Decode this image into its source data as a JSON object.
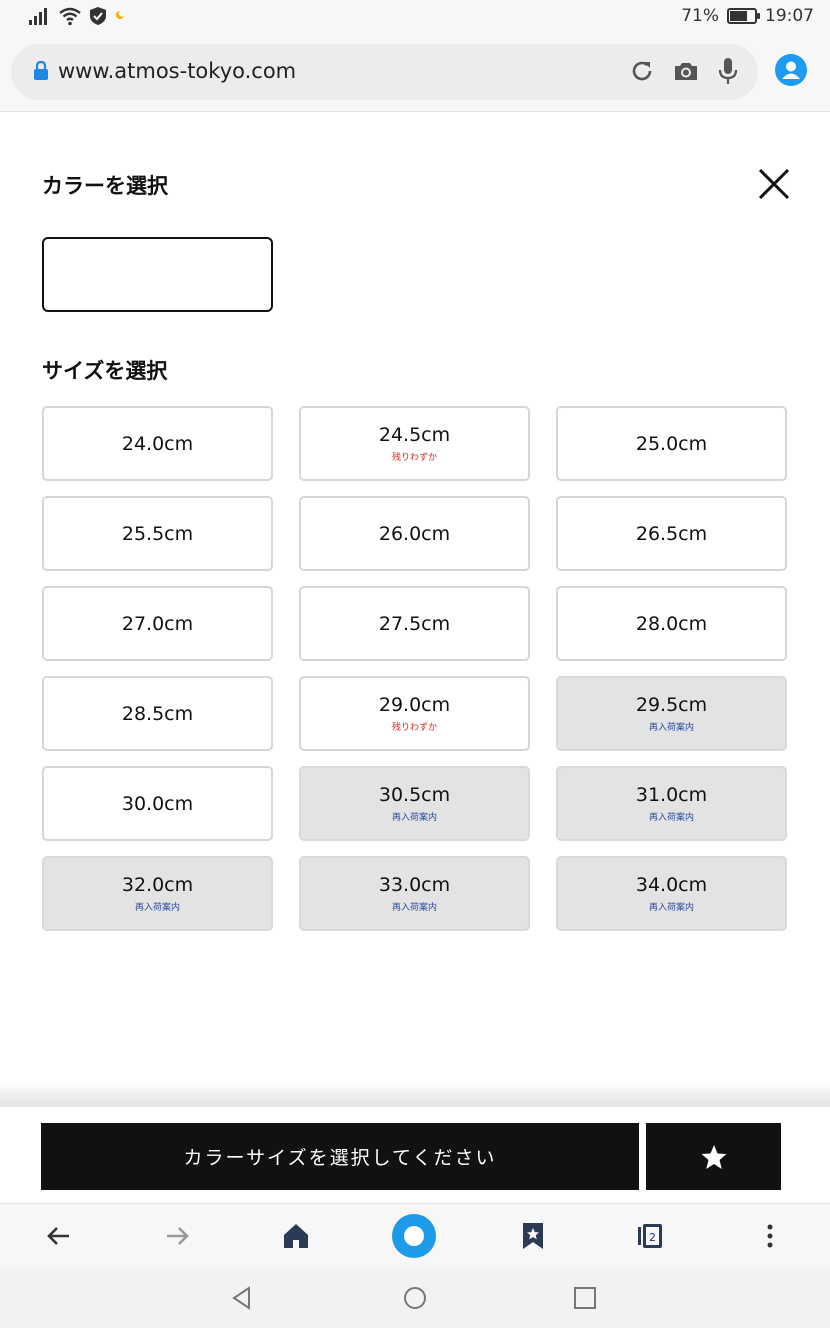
{
  "status_bar": {
    "battery": "71%",
    "time": "19:07",
    "battery_level": 0.71
  },
  "browser": {
    "url": "www.atmos-tokyo.com",
    "tab_count": "2"
  },
  "modal": {
    "color_heading": "カラーを選択",
    "size_heading": "サイズを選択",
    "color_value": "",
    "sizes": [
      {
        "label": "24.0cm",
        "note": "",
        "state": "available"
      },
      {
        "label": "24.5cm",
        "note": "残りわずか",
        "state": "low"
      },
      {
        "label": "25.0cm",
        "note": "",
        "state": "available"
      },
      {
        "label": "25.5cm",
        "note": "",
        "state": "available"
      },
      {
        "label": "26.0cm",
        "note": "",
        "state": "available"
      },
      {
        "label": "26.5cm",
        "note": "",
        "state": "available"
      },
      {
        "label": "27.0cm",
        "note": "",
        "state": "available"
      },
      {
        "label": "27.5cm",
        "note": "",
        "state": "available"
      },
      {
        "label": "28.0cm",
        "note": "",
        "state": "available"
      },
      {
        "label": "28.5cm",
        "note": "",
        "state": "available"
      },
      {
        "label": "29.0cm",
        "note": "残りわずか",
        "state": "low"
      },
      {
        "label": "29.5cm",
        "note": "再入荷案内",
        "state": "restock"
      },
      {
        "label": "30.0cm",
        "note": "",
        "state": "available"
      },
      {
        "label": "30.5cm",
        "note": "再入荷案内",
        "state": "restock"
      },
      {
        "label": "31.0cm",
        "note": "再入荷案内",
        "state": "restock"
      },
      {
        "label": "32.0cm",
        "note": "再入荷案内",
        "state": "restock"
      },
      {
        "label": "33.0cm",
        "note": "再入荷案内",
        "state": "restock"
      },
      {
        "label": "34.0cm",
        "note": "再入荷案内",
        "state": "restock"
      }
    ]
  },
  "action_bar": {
    "select_label": "カラーサイズを選択してください",
    "favorite_icon": "star-icon"
  },
  "colors": {
    "accent": "#1e9be8",
    "low_stock": "#d9261c",
    "restock": "#2d4a9c",
    "sold_bg": "#e3e3e3",
    "button_bg": "#111111"
  }
}
